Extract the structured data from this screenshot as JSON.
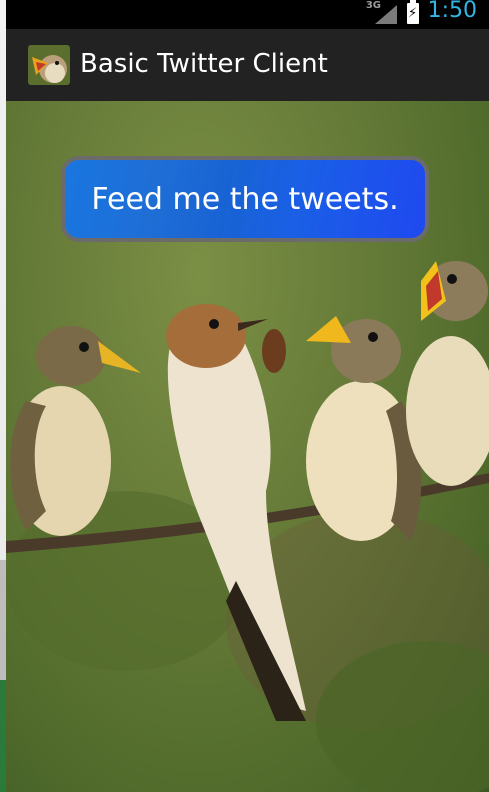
{
  "status_bar": {
    "network": "3G",
    "time": "1:50",
    "signal_icon": "signal-icon",
    "battery_icon": "battery-charging-icon",
    "accent_color": "#33b5e5"
  },
  "action_bar": {
    "title": "Basic Twitter Client",
    "icon": "bird-app-icon"
  },
  "main": {
    "feed_button_label": "Feed me the tweets.",
    "background": "bird-photo"
  }
}
